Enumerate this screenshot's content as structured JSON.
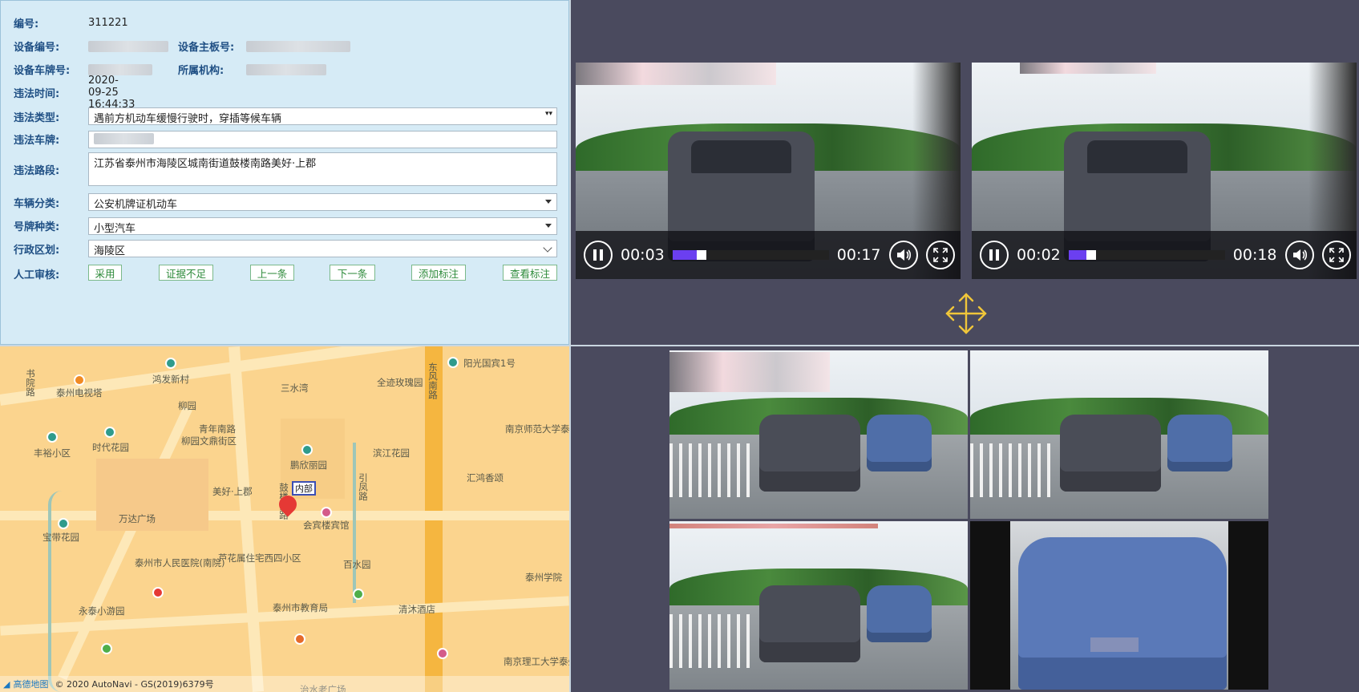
{
  "form": {
    "id_label": "编号:",
    "id_value": "311221",
    "device_no_label": "设备编号:",
    "device_board_label": "设备主板号:",
    "device_plate_label": "设备车牌号:",
    "org_label": "所属机构:",
    "time_label": "违法时间:",
    "time_value": "2020-09-25 16:44:33",
    "type_label": "违法类型:",
    "type_value": "遇前方机动车缓慢行驶时，穿插等候车辆",
    "plate_label": "违法车牌:",
    "road_label": "违法路段:",
    "road_value": "江苏省泰州市海陵区城南街道鼓楼南路美好·上郡",
    "vehicle_class_label": "车辆分类:",
    "vehicle_class_value": "公安机牌证机动车",
    "plate_type_label": "号牌种类:",
    "plate_type_value": "小型汽车",
    "district_label": "行政区划:",
    "district_value": "海陵区",
    "review_label": "人工审核:",
    "buttons": {
      "adopt": "采用",
      "insufficient": "证据不足",
      "prev": "上一条",
      "next": "下一条",
      "add_mark": "添加标注",
      "view_mark": "查看标注"
    }
  },
  "players": [
    {
      "current": "00:03",
      "duration": "00:17",
      "progress": 0.18
    },
    {
      "current": "00:02",
      "duration": "00:18",
      "progress": 0.12
    }
  ],
  "map": {
    "labels": [
      "泰州电视塔",
      "鸿发新村",
      "柳园",
      "青年南路",
      "丰裕小区",
      "时代花园",
      "柳园文鼎街区",
      "鹏欣丽园",
      "美好·上郡",
      "万达广场",
      "宝带花园",
      "阳光国宾1号",
      "全迹玫瑰园",
      "滨江花园",
      "汇鸿香颂",
      "会宾楼宾馆",
      "泰州市人民医院(南院)",
      "芦花属住宅西四小区",
      "百水园",
      "永泰小游园",
      "泰州市教育局",
      "清沐酒店",
      "南京师范大学泰州学院",
      "泰州学院",
      "南京理工大学泰州科技学院",
      "东风南路",
      "鼓楼南路",
      "书院路",
      "三水湾",
      "引凤路",
      "治水老广场"
    ],
    "popup": "内部",
    "attribution": "© 2020 AutoNavi - GS(2019)6379号",
    "logo_text": "高德地图"
  },
  "colors": {
    "form_bg": "#d6ebf6",
    "label": "#1f4f84",
    "button_text": "#2d8a3a",
    "progress": "#6b3ff0",
    "move_icon": "#f0c63a",
    "map_bg": "#fbd48e",
    "marker": "#e53935"
  }
}
